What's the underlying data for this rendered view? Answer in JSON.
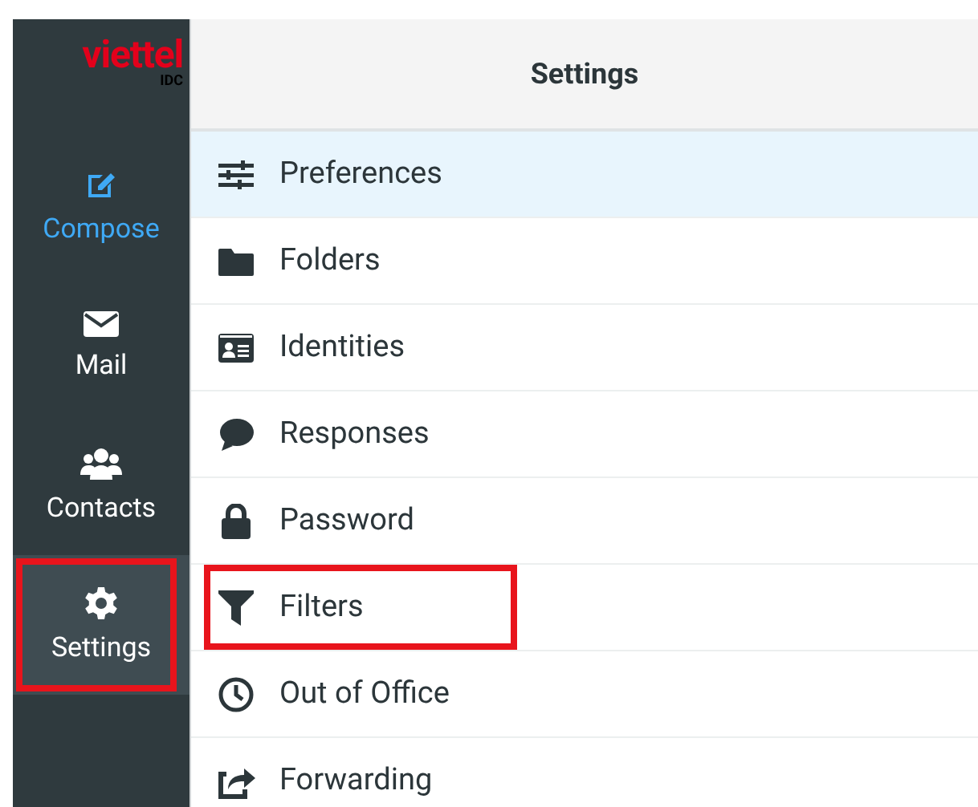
{
  "logo": {
    "brand": "viettel",
    "sub": "IDC"
  },
  "nav": [
    {
      "kind": "compose",
      "label": "Compose",
      "selected": false,
      "highlighted": false
    },
    {
      "kind": "mail",
      "label": "Mail",
      "selected": false,
      "highlighted": false
    },
    {
      "kind": "contacts",
      "label": "Contacts",
      "selected": false,
      "highlighted": false
    },
    {
      "kind": "settings",
      "label": "Settings",
      "selected": true,
      "highlighted": true
    }
  ],
  "header": {
    "title": "Settings"
  },
  "sections": [
    {
      "kind": "preferences",
      "label": "Preferences",
      "selected": true,
      "highlighted": false
    },
    {
      "kind": "folders",
      "label": "Folders",
      "selected": false,
      "highlighted": false
    },
    {
      "kind": "identities",
      "label": "Identities",
      "selected": false,
      "highlighted": false
    },
    {
      "kind": "responses",
      "label": "Responses",
      "selected": false,
      "highlighted": false
    },
    {
      "kind": "password",
      "label": "Password",
      "selected": false,
      "highlighted": false
    },
    {
      "kind": "filters",
      "label": "Filters",
      "selected": false,
      "highlighted": true
    },
    {
      "kind": "outofoffice",
      "label": "Out of Office",
      "selected": false,
      "highlighted": false
    },
    {
      "kind": "forwarding",
      "label": "Forwarding",
      "selected": false,
      "highlighted": false
    }
  ]
}
